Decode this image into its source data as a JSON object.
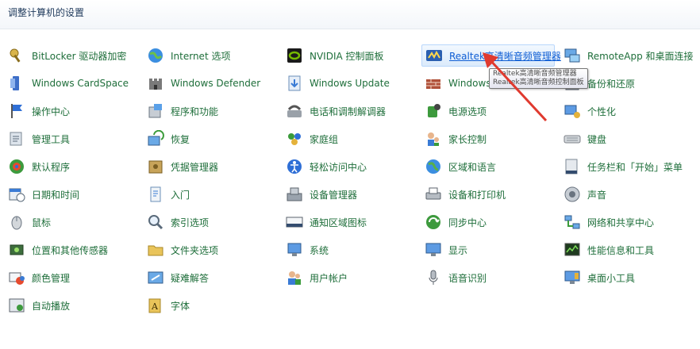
{
  "header": {
    "title": "调整计算机的设置"
  },
  "items": [
    {
      "label": "BitLocker 驱动器加密",
      "icon": "bitlocker-key-icon"
    },
    {
      "label": "Internet 选项",
      "icon": "globe-icon"
    },
    {
      "label": "NVIDIA 控制面板",
      "icon": "nvidia-icon"
    },
    {
      "label": "Realtek高清晰音频管理器",
      "icon": "realtek-audio-icon"
    },
    {
      "label": "RemoteApp 和桌面连接",
      "icon": "remote-desktop-icon"
    },
    {
      "label": "Windows CardSpace",
      "icon": "cardspace-icon"
    },
    {
      "label": "Windows Defender",
      "icon": "castle-icon"
    },
    {
      "label": "Windows Update",
      "icon": "update-icon"
    },
    {
      "label": "Windows",
      "icon": "firewall-icon"
    },
    {
      "label": "备份和还原",
      "icon": "backup-icon"
    },
    {
      "label": "操作中心",
      "icon": "flag-icon"
    },
    {
      "label": "程序和功能",
      "icon": "programs-icon"
    },
    {
      "label": "电话和调制解调器",
      "icon": "phone-modem-icon"
    },
    {
      "label": "电源选项",
      "icon": "power-icon"
    },
    {
      "label": "个性化",
      "icon": "personalize-icon"
    },
    {
      "label": "管理工具",
      "icon": "admin-tools-icon"
    },
    {
      "label": "恢复",
      "icon": "restore-icon"
    },
    {
      "label": "家庭组",
      "icon": "homegroup-icon"
    },
    {
      "label": "家长控制",
      "icon": "parental-icon"
    },
    {
      "label": "键盘",
      "icon": "keyboard-icon"
    },
    {
      "label": "默认程序",
      "icon": "default-programs-icon"
    },
    {
      "label": "凭据管理器",
      "icon": "vault-icon"
    },
    {
      "label": "轻松访问中心",
      "icon": "ease-access-icon"
    },
    {
      "label": "区域和语言",
      "icon": "region-globe-icon"
    },
    {
      "label": "任务栏和「开始」菜单",
      "icon": "taskbar-icon"
    },
    {
      "label": "日期和时间",
      "icon": "calendar-clock-icon"
    },
    {
      "label": "入门",
      "icon": "getting-started-icon"
    },
    {
      "label": "设备管理器",
      "icon": "device-manager-icon"
    },
    {
      "label": "设备和打印机",
      "icon": "printer-icon"
    },
    {
      "label": "声音",
      "icon": "speaker-icon"
    },
    {
      "label": "鼠标",
      "icon": "mouse-icon"
    },
    {
      "label": "索引选项",
      "icon": "index-search-icon"
    },
    {
      "label": "通知区域图标",
      "icon": "notification-area-icon"
    },
    {
      "label": "同步中心",
      "icon": "sync-icon"
    },
    {
      "label": "网络和共享中心",
      "icon": "network-icon"
    },
    {
      "label": "位置和其他传感器",
      "icon": "sensor-icon"
    },
    {
      "label": "文件夹选项",
      "icon": "folder-icon"
    },
    {
      "label": "系统",
      "icon": "system-icon"
    },
    {
      "label": "显示",
      "icon": "display-icon"
    },
    {
      "label": "性能信息和工具",
      "icon": "performance-icon"
    },
    {
      "label": "颜色管理",
      "icon": "color-management-icon"
    },
    {
      "label": "疑难解答",
      "icon": "troubleshoot-icon"
    },
    {
      "label": "用户帐户",
      "icon": "user-accounts-icon"
    },
    {
      "label": "语音识别",
      "icon": "microphone-icon"
    },
    {
      "label": "桌面小工具",
      "icon": "gadgets-icon"
    },
    {
      "label": "自动播放",
      "icon": "autoplay-icon"
    },
    {
      "label": "字体",
      "icon": "fonts-icon"
    }
  ],
  "hovered_index": 3,
  "tooltip": {
    "line1": "Realtek高清晰音频管理器",
    "line2": "Realtek高清晰音频控制面板"
  },
  "colors": {
    "link": "#1e6e3a",
    "hover_link": "#0f5ed4",
    "header_text": "#1e395b",
    "arrow": "#e03a2f"
  }
}
